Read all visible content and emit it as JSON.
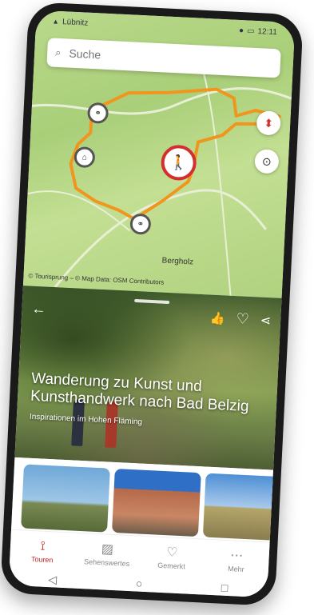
{
  "status": {
    "carrier": "Lübnitz",
    "time": "12:11"
  },
  "search": {
    "placeholder": "Suche"
  },
  "map": {
    "place_label": "Bergholz",
    "attribution": "© Tourisprung – © Map Data: OSM Contributors"
  },
  "card": {
    "title": "Wanderung zu Kunst und Kunsthandwerk nach Bad Belzig",
    "subtitle": "Inspirationen im Hohen Fläming"
  },
  "nav": {
    "items": [
      {
        "label": "Touren",
        "icon": "route-icon"
      },
      {
        "label": "Sehenswertes",
        "icon": "picture-icon"
      },
      {
        "label": "Gemerkt",
        "icon": "heart-icon"
      },
      {
        "label": "Mehr",
        "icon": "more-icon"
      }
    ]
  },
  "colors": {
    "accent": "#c62828",
    "route": "#f0961e"
  }
}
